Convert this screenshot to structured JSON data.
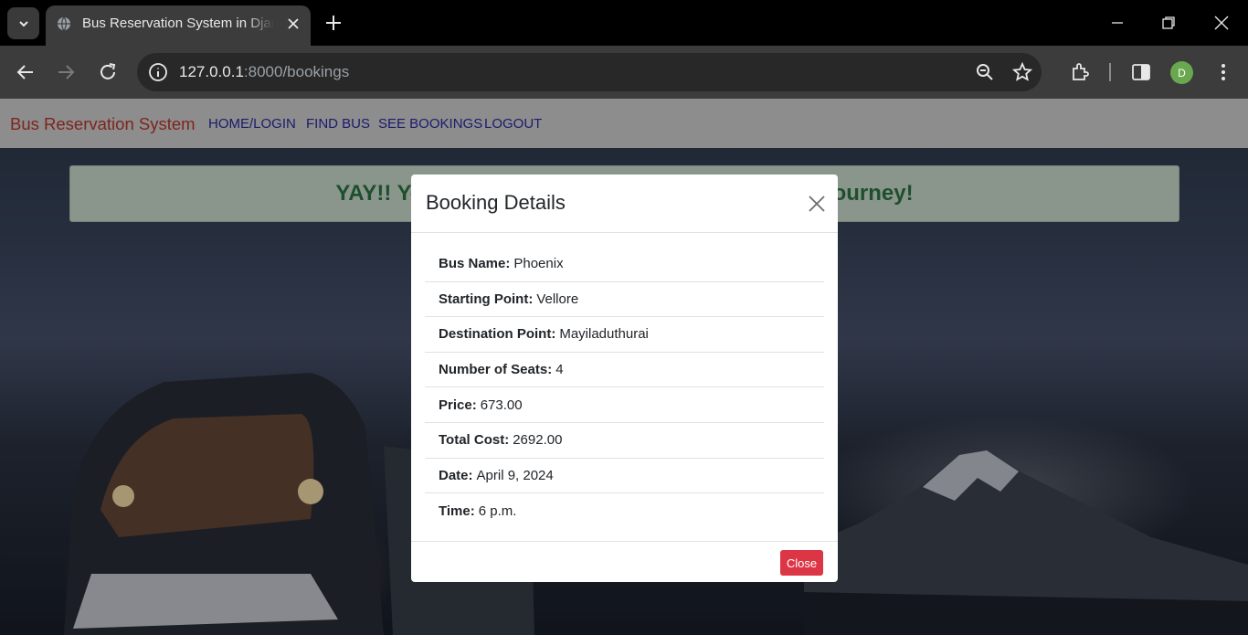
{
  "browser": {
    "tab_title": "Bus Reservation System in Django",
    "url_host": "127.0.0.1",
    "url_rest": ":8000/bookings",
    "profile_initial": "D",
    "colors": {
      "tabbar": "#000000",
      "toolbar": "#3c3c3c",
      "omnibox": "#282828",
      "avatar": "#6aa84f"
    }
  },
  "navbar": {
    "brand": "Bus Reservation System",
    "links": [
      "HOME/LOGIN",
      "FIND BUS",
      "SEE BOOKINGS",
      "LOGOUT"
    ],
    "colors": {
      "brand": "#c0392b",
      "links": "#2a2aa8",
      "background": "#d9d9d9"
    }
  },
  "alert": {
    "text": "YAY!! Your Booking is Confirmed. Have a Safe Journey!",
    "color": "#2f7a45"
  },
  "modal": {
    "title": "Booking Details",
    "items": [
      {
        "label": "Bus Name:",
        "value": "Phoenix"
      },
      {
        "label": "Starting Point:",
        "value": "Vellore"
      },
      {
        "label": "Destination Point:",
        "value": "Mayiladuthurai"
      },
      {
        "label": "Number of Seats:",
        "value": "4"
      },
      {
        "label": "Price:",
        "value": "673.00"
      },
      {
        "label": "Total Cost:",
        "value": "2692.00"
      },
      {
        "label": "Date:",
        "value": "April 9, 2024"
      },
      {
        "label": "Time:",
        "value": "6 p.m."
      }
    ],
    "close_label": "Close",
    "close_color": "#dc3545"
  }
}
